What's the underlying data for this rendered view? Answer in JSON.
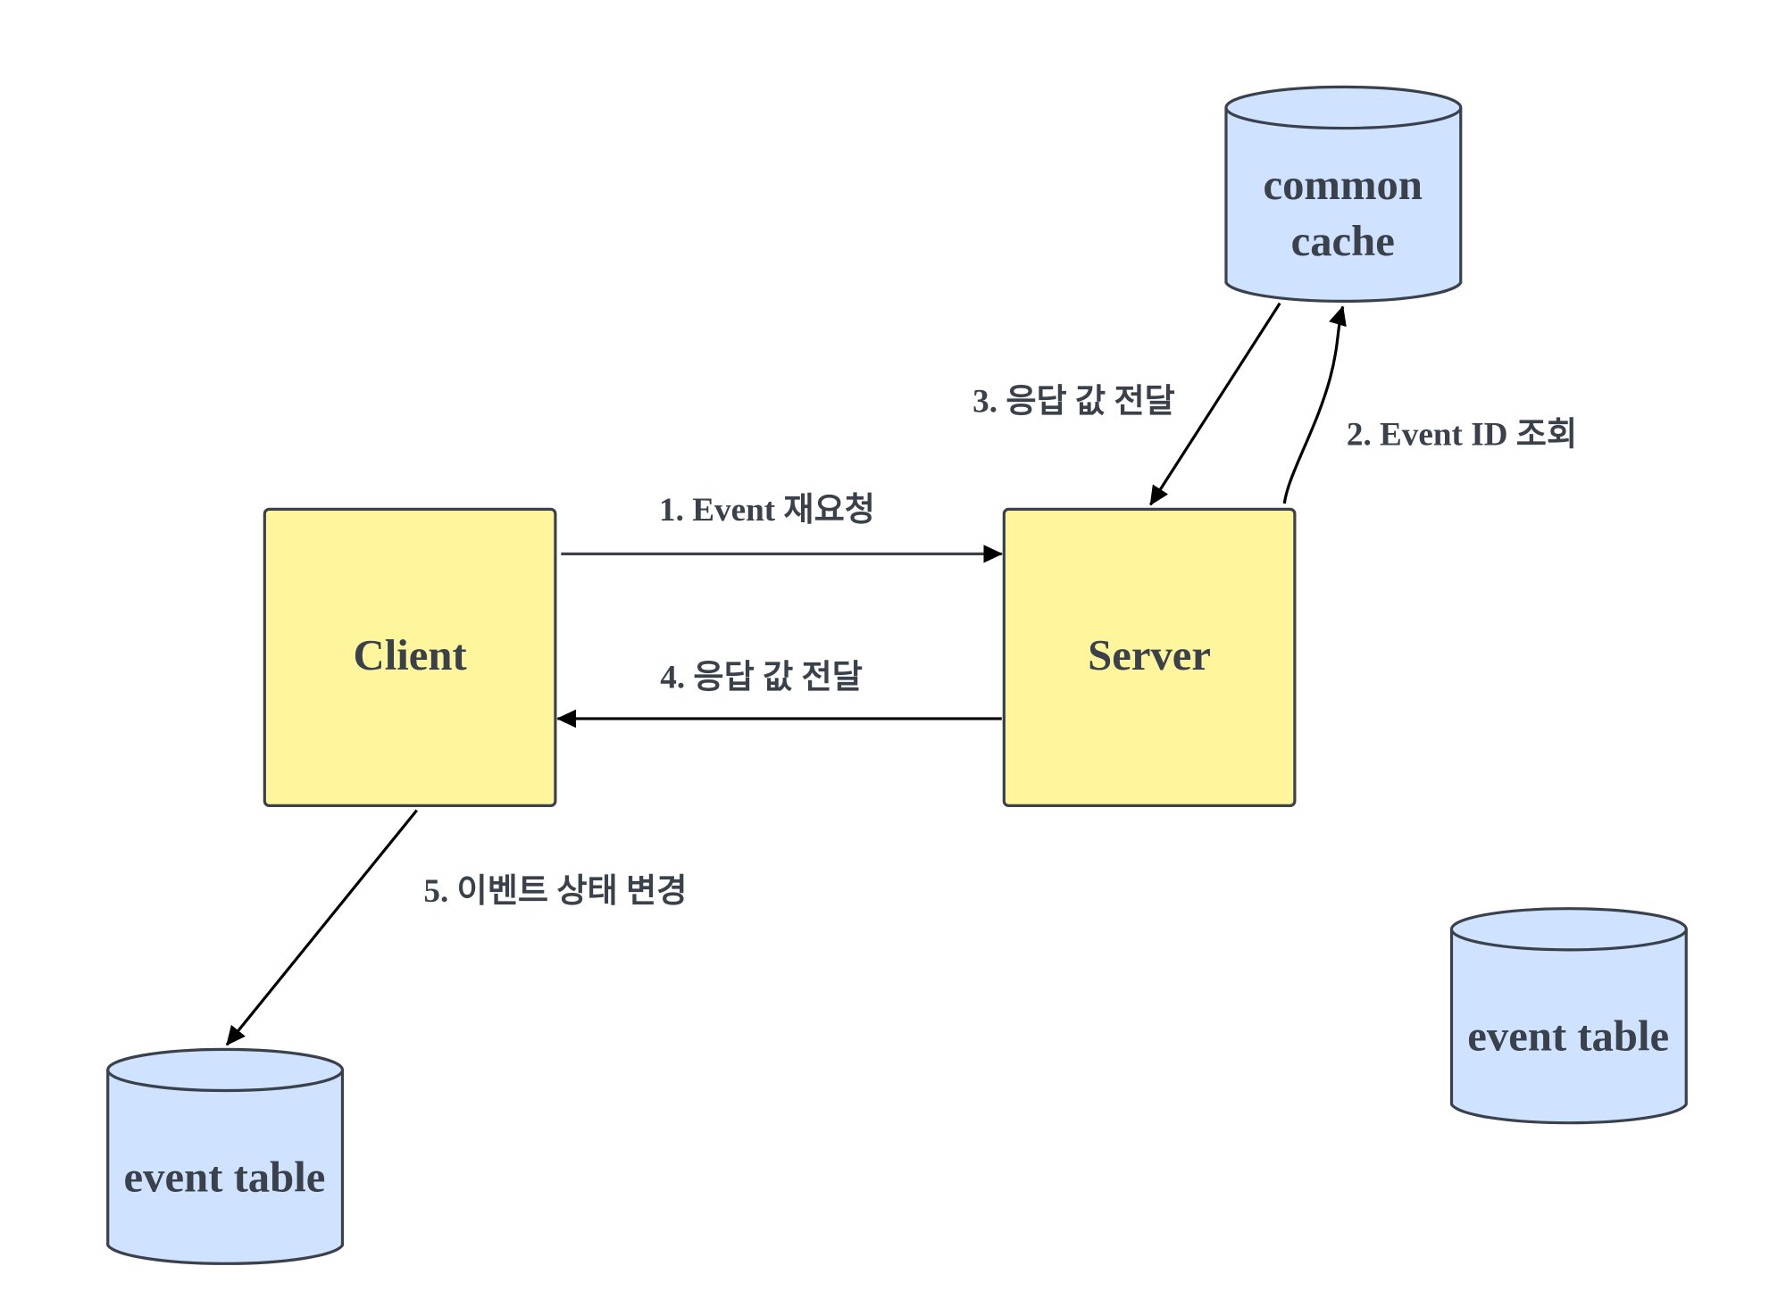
{
  "colors": {
    "process_fill": "#fff59d",
    "store_fill": "#cfe2ff",
    "stroke": "#3a414b",
    "text": "#3a414b"
  },
  "nodes": {
    "client": "Client",
    "server": "Server",
    "cache_line1": "common",
    "cache_line2": "cache",
    "event_table_left": "event table",
    "event_table_right": "event table"
  },
  "edges": {
    "e1": "1. Event 재요청",
    "e2": "2. Event ID 조회",
    "e3": "3. 응답 값 전달",
    "e4": "4. 응답 값 전달",
    "e5": "5. 이벤트 상태 변경"
  }
}
